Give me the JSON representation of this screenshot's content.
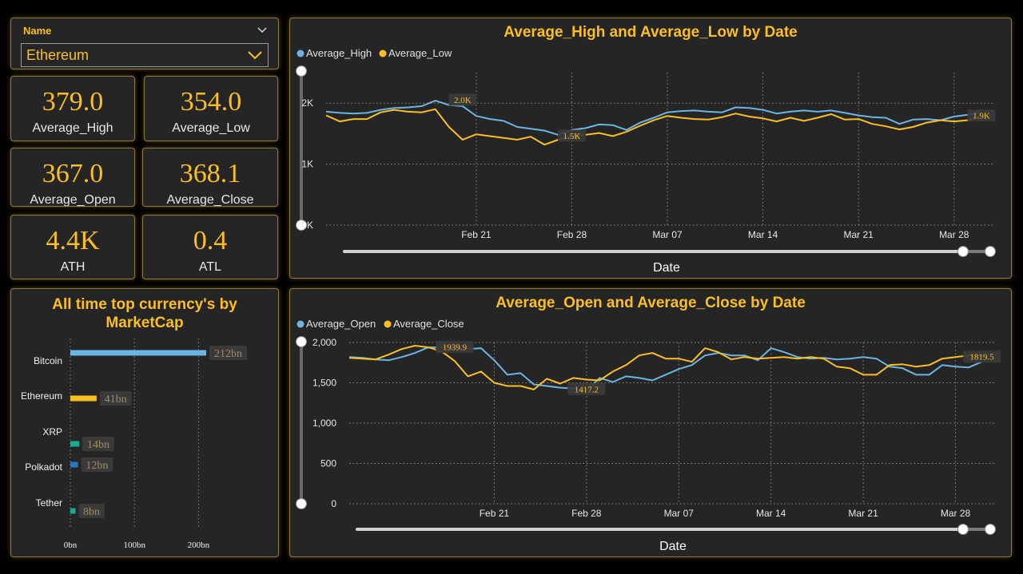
{
  "slicer": {
    "title": "Name",
    "selected": "Ethereum"
  },
  "kpis": {
    "avg_high": {
      "value": "379.0",
      "label": "Average_High"
    },
    "avg_low": {
      "value": "354.0",
      "label": "Average_Low"
    },
    "avg_open": {
      "value": "367.0",
      "label": "Average_Open"
    },
    "avg_close": {
      "value": "368.1",
      "label": "Average_Close"
    },
    "ath": {
      "value": "4.4K",
      "label": "ATH"
    },
    "atl": {
      "value": "0.4",
      "label": "ATL"
    }
  },
  "colors": {
    "accent": "#fbbf24",
    "series_blue": "#6cb4e4",
    "series_yellow": "#fbbf24",
    "bitcoin": "#6cb4e4",
    "ethereum": "#fbbf24",
    "xrp": "#1aab8c",
    "polkadot": "#2f74c0",
    "tether": "#1aab8c"
  },
  "chart_data": [
    {
      "type": "line",
      "title": "Average_High and Average_Low by Date",
      "xlabel": "Date",
      "ylabel": "",
      "x_ticks": [
        "Feb 21",
        "Feb 28",
        "Mar 07",
        "Mar 14",
        "Mar 21",
        "Mar 28"
      ],
      "x_tick_days": [
        5,
        12,
        19,
        26,
        33,
        40
      ],
      "y_ticks": [
        "0K",
        "1K",
        "2K"
      ],
      "y_tick_values": [
        0,
        1000,
        2000
      ],
      "ylim": [
        0,
        2500
      ],
      "xlim_days": [
        -6,
        43
      ],
      "grid": true,
      "legend": "top-left",
      "data_labels": [
        {
          "day": 4,
          "y": 2050,
          "text": "2.0K",
          "series": "Average_High"
        },
        {
          "day": 12,
          "y": 1460,
          "text": "1.5K",
          "series": "Average_Low"
        },
        {
          "day": 42,
          "y": 1790,
          "text": "1.9K",
          "series": "Average_Low"
        }
      ],
      "series": [
        {
          "name": "Average_High",
          "color": "#6cb4e4",
          "days": [
            -6,
            -5,
            -4,
            -3,
            -2,
            -1,
            0,
            1,
            2,
            3,
            4,
            5,
            6,
            7,
            8,
            9,
            10,
            11,
            12,
            13,
            14,
            15,
            16,
            17,
            18,
            19,
            20,
            21,
            22,
            23,
            24,
            25,
            26,
            27,
            28,
            29,
            30,
            31,
            32,
            33,
            34,
            35,
            36,
            37,
            38,
            39,
            40,
            41,
            42
          ],
          "values": [
            1860,
            1840,
            1830,
            1840,
            1890,
            1920,
            1930,
            1950,
            2040,
            1970,
            1950,
            1790,
            1740,
            1710,
            1610,
            1580,
            1550,
            1480,
            1560,
            1590,
            1650,
            1640,
            1560,
            1680,
            1760,
            1850,
            1870,
            1880,
            1860,
            1850,
            1930,
            1920,
            1890,
            1830,
            1860,
            1880,
            1860,
            1880,
            1840,
            1800,
            1770,
            1760,
            1660,
            1730,
            1740,
            1720,
            1780,
            1810,
            1850
          ]
        },
        {
          "name": "Average_Low",
          "color": "#fbbf24",
          "days": [
            -6,
            -5,
            -4,
            -3,
            -2,
            -1,
            0,
            1,
            2,
            3,
            4,
            5,
            6,
            7,
            8,
            9,
            10,
            11,
            12,
            13,
            14,
            15,
            16,
            17,
            18,
            19,
            20,
            21,
            22,
            23,
            24,
            25,
            26,
            27,
            28,
            29,
            30,
            31,
            32,
            33,
            34,
            35,
            36,
            37,
            38,
            39,
            40,
            41,
            42
          ],
          "values": [
            1800,
            1700,
            1740,
            1740,
            1850,
            1890,
            1860,
            1850,
            1900,
            1610,
            1400,
            1490,
            1460,
            1430,
            1400,
            1450,
            1320,
            1400,
            1460,
            1480,
            1510,
            1460,
            1530,
            1630,
            1720,
            1790,
            1760,
            1740,
            1730,
            1770,
            1830,
            1780,
            1750,
            1700,
            1760,
            1710,
            1760,
            1820,
            1730,
            1740,
            1660,
            1620,
            1570,
            1610,
            1680,
            1720,
            1700,
            1720,
            1790
          ]
        }
      ]
    },
    {
      "type": "line",
      "title": "Average_Open and Average_Close by Date",
      "xlabel": "Date",
      "ylabel": "",
      "x_ticks": [
        "Feb 21",
        "Feb 28",
        "Mar 07",
        "Mar 14",
        "Mar 21",
        "Mar 28"
      ],
      "x_tick_days": [
        5,
        12,
        19,
        26,
        33,
        40
      ],
      "y_ticks": [
        "0",
        "500",
        "1,000",
        "1,500",
        "2,000"
      ],
      "y_tick_values": [
        0,
        500,
        1000,
        1500,
        2000
      ],
      "ylim": [
        0,
        2000
      ],
      "xlim_days": [
        -6,
        43
      ],
      "grid": true,
      "legend": "top-left",
      "data_labels": [
        {
          "day": 2,
          "y": 1939.9,
          "text": "1939.9",
          "series": "Average_Open"
        },
        {
          "day": 12,
          "y": 1417.2,
          "text": "1417.2",
          "series": "Average_Close"
        },
        {
          "day": 42,
          "y": 1819.5,
          "text": "1819.5",
          "series": "Average_Close"
        }
      ],
      "series": [
        {
          "name": "Average_Open",
          "color": "#6cb4e4",
          "days": [
            -6,
            -5,
            -4,
            -3,
            -2,
            -1,
            0,
            1,
            2,
            3,
            4,
            5,
            6,
            7,
            8,
            9,
            10,
            11,
            12,
            13,
            14,
            15,
            16,
            17,
            18,
            19,
            20,
            21,
            22,
            23,
            24,
            25,
            26,
            27,
            28,
            29,
            30,
            31,
            32,
            33,
            34,
            35,
            36,
            37,
            38,
            39,
            40,
            41,
            42
          ],
          "values": [
            1820,
            1810,
            1790,
            1780,
            1820,
            1870,
            1940,
            1940,
            1930,
            1920,
            1930,
            1780,
            1600,
            1620,
            1480,
            1460,
            1440,
            1430,
            1400,
            1560,
            1510,
            1580,
            1560,
            1530,
            1600,
            1670,
            1720,
            1840,
            1870,
            1840,
            1840,
            1780,
            1930,
            1880,
            1820,
            1800,
            1810,
            1790,
            1800,
            1820,
            1800,
            1700,
            1680,
            1600,
            1600,
            1720,
            1700,
            1690,
            1760
          ]
        },
        {
          "name": "Average_Close",
          "color": "#fbbf24",
          "days": [
            -6,
            -5,
            -4,
            -3,
            -2,
            -1,
            0,
            1,
            2,
            3,
            4,
            5,
            6,
            7,
            8,
            9,
            10,
            11,
            12,
            13,
            14,
            15,
            16,
            17,
            18,
            19,
            20,
            21,
            22,
            23,
            24,
            25,
            26,
            27,
            28,
            29,
            30,
            31,
            32,
            33,
            34,
            35,
            36,
            37,
            38,
            39,
            40,
            41,
            42
          ],
          "values": [
            1810,
            1800,
            1790,
            1850,
            1920,
            1960,
            1939.9,
            1890,
            1770,
            1580,
            1640,
            1500,
            1460,
            1460,
            1417.2,
            1550,
            1490,
            1560,
            1540,
            1530,
            1640,
            1720,
            1840,
            1870,
            1800,
            1800,
            1760,
            1930,
            1880,
            1790,
            1820,
            1800,
            1810,
            1820,
            1800,
            1820,
            1800,
            1700,
            1680,
            1600,
            1600,
            1720,
            1730,
            1700,
            1720,
            1800,
            1819.5,
            1840,
            1840
          ]
        }
      ]
    },
    {
      "type": "bar",
      "orientation": "horizontal",
      "title": "All time top currency's by MarketCap",
      "categories": [
        "Bitcoin",
        "Ethereum",
        "XRP",
        "Polkadot",
        "Tether"
      ],
      "values": [
        212,
        41,
        14,
        12,
        8
      ],
      "value_labels": [
        "212bn",
        "41bn",
        "14bn",
        "12bn",
        "8bn"
      ],
      "x_ticks": [
        "0bn",
        "100bn",
        "200bn"
      ],
      "x_tick_values": [
        0,
        100,
        200
      ],
      "xlim": [
        0,
        212
      ],
      "grid": true
    }
  ]
}
